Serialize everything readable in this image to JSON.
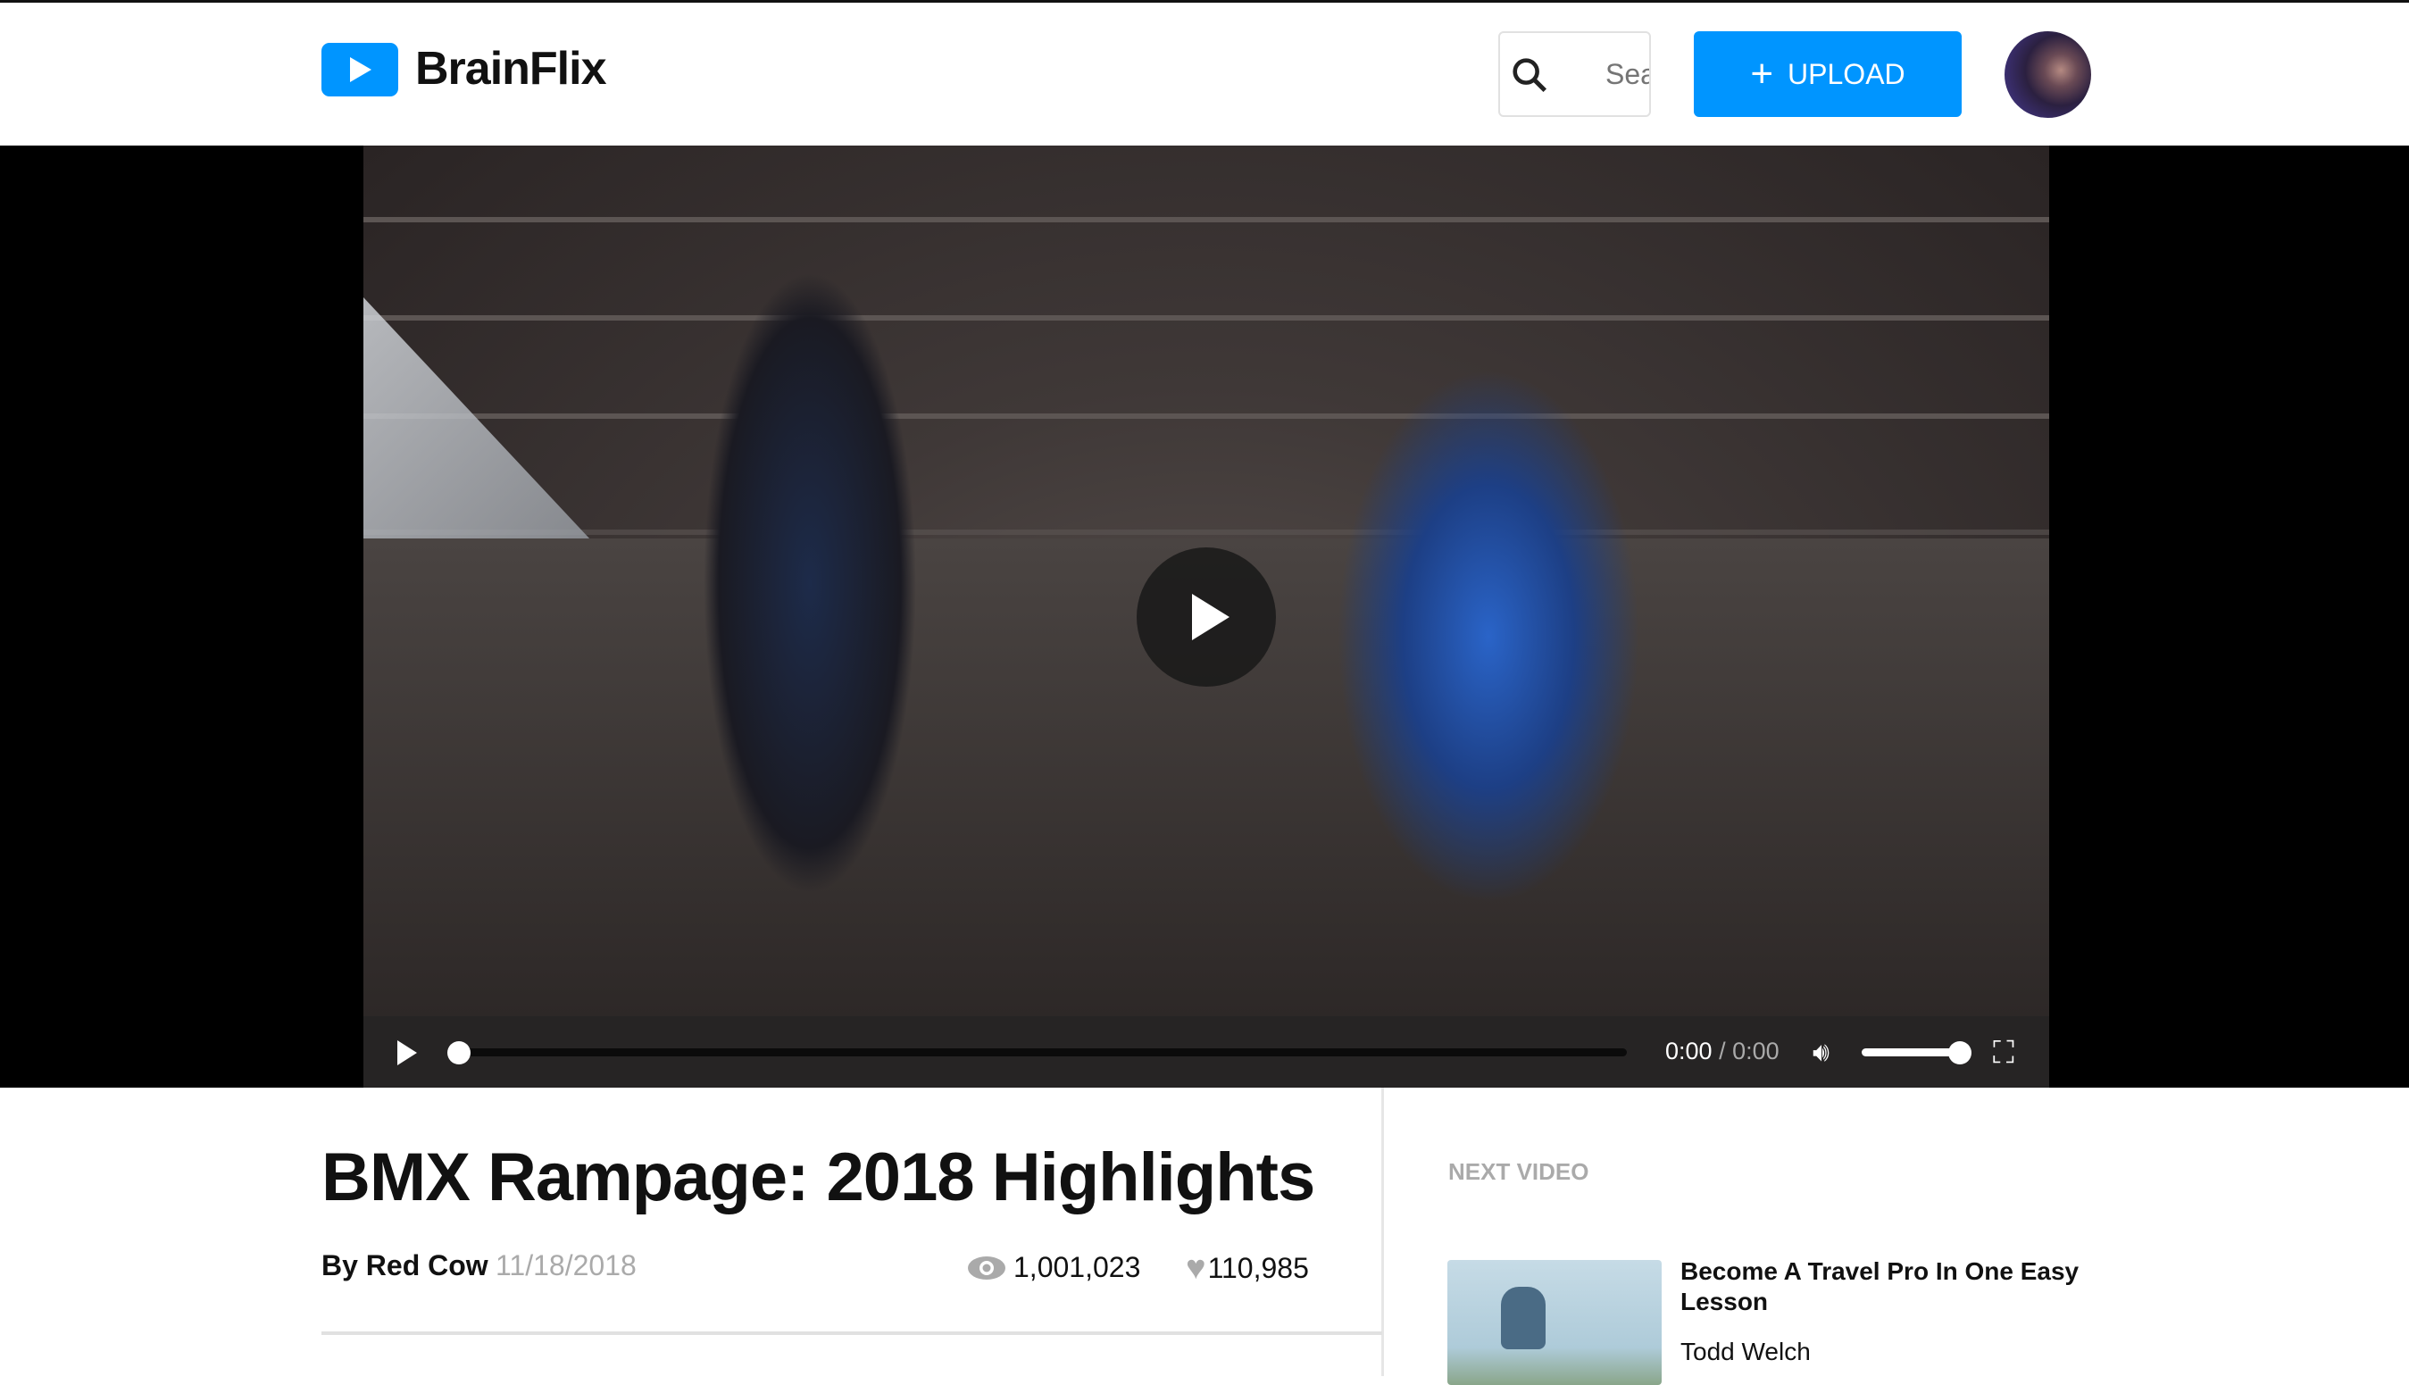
{
  "header": {
    "brand": "BrainFlix",
    "search_placeholder": "Search",
    "upload_label": "UPLOAD"
  },
  "player": {
    "current_time": "0:00",
    "separator": " / ",
    "duration": "0:00",
    "progress": 0,
    "volume": 1
  },
  "video": {
    "title": "BMX Rampage: 2018 Highlights",
    "author": "By Red Cow",
    "date": "11/18/2018",
    "views": "1,001,023",
    "likes": "110,985"
  },
  "sidebar": {
    "heading": "NEXT VIDEO",
    "items": [
      {
        "title": "Become A Travel Pro In One Easy Lesson",
        "author": "Todd Welch"
      }
    ]
  },
  "colors": {
    "accent": "#0095ff"
  }
}
